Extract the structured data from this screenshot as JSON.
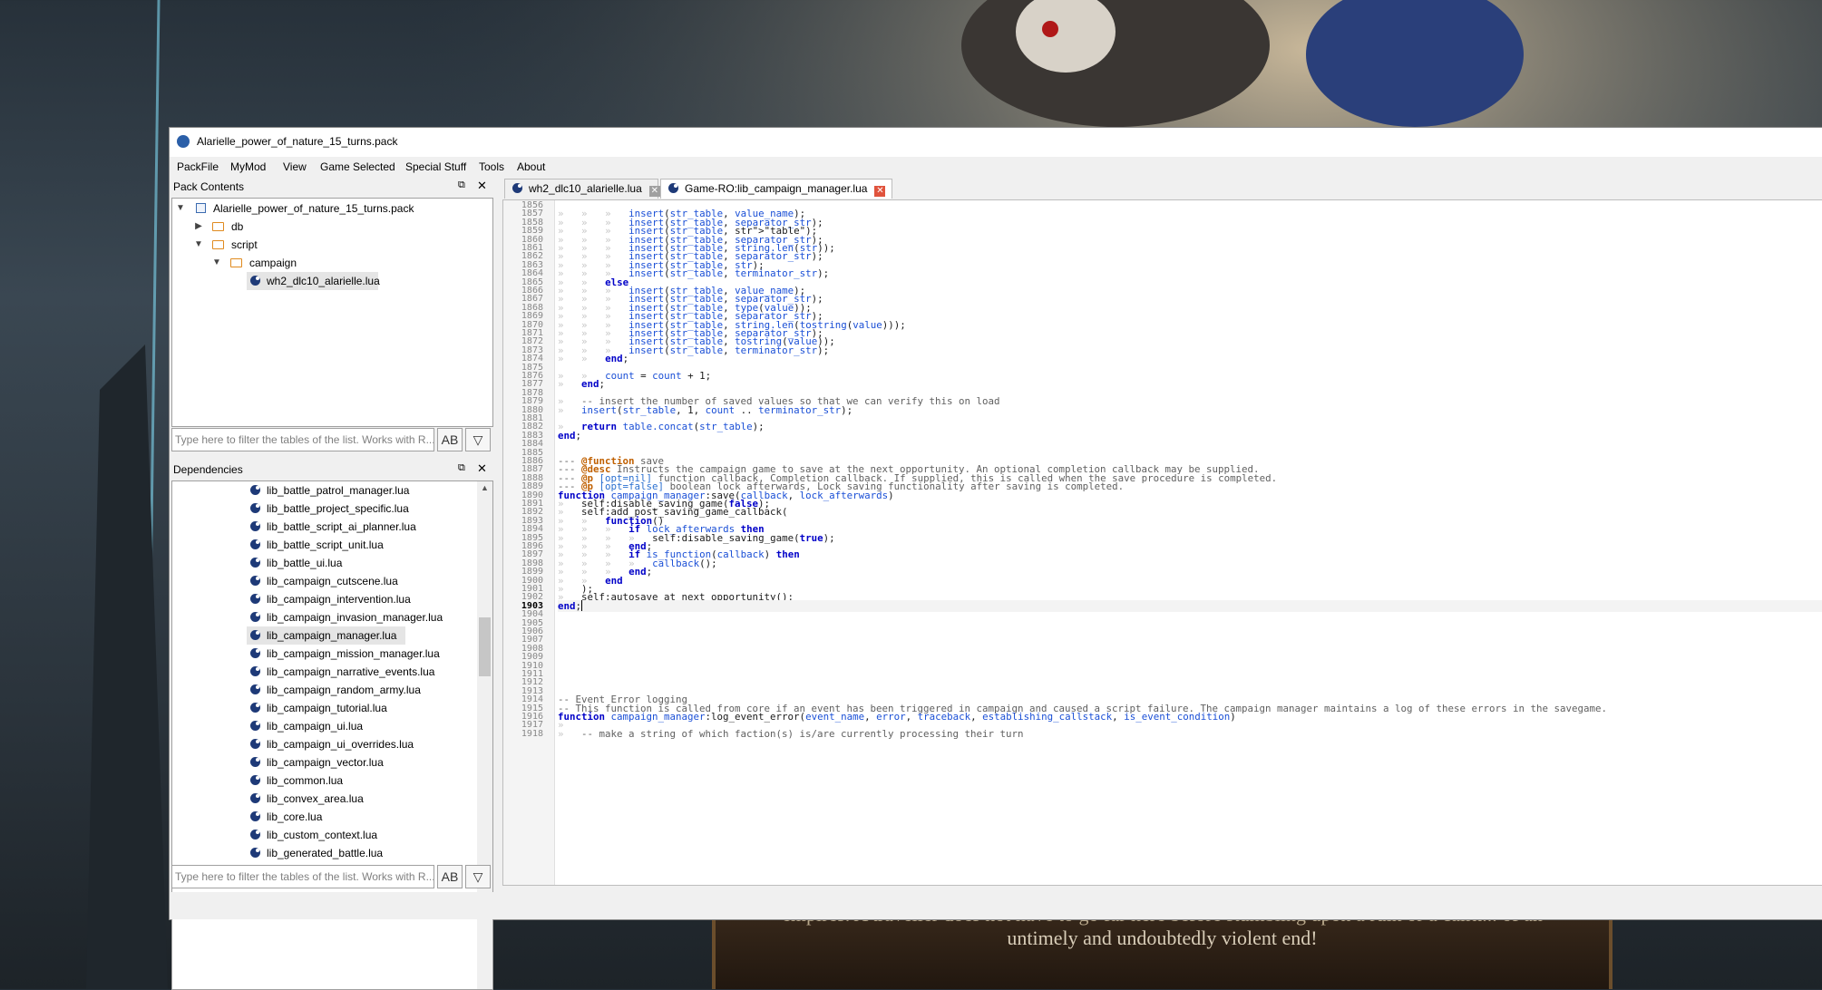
{
  "window": {
    "title": "Alarielle_power_of_nature_15_turns.pack"
  },
  "menu": [
    "PackFile",
    "MyMod",
    "View",
    "Game Selected",
    "Special Stuff",
    "Tools",
    "About"
  ],
  "pack_contents": {
    "title": "Pack Contents",
    "items": [
      {
        "label": "Alarielle_power_of_nature_15_turns.pack",
        "kind": "pack",
        "level": 0,
        "expanded": true
      },
      {
        "label": "db",
        "kind": "folder",
        "level": 1,
        "expanded": false
      },
      {
        "label": "script",
        "kind": "folder",
        "level": 1,
        "expanded": true
      },
      {
        "label": "campaign",
        "kind": "folder",
        "level": 2,
        "expanded": true
      },
      {
        "label": "wh2_dlc10_alarielle.lua",
        "kind": "lua",
        "level": 3,
        "selected": true
      }
    ],
    "filter_placeholder": "Type here to filter the tables of the list. Works with R...",
    "case_button": "AB"
  },
  "dependencies": {
    "title": "Dependencies",
    "items": [
      "lib_battle_patrol_manager.lua",
      "lib_battle_project_specific.lua",
      "lib_battle_script_ai_planner.lua",
      "lib_battle_script_unit.lua",
      "lib_battle_ui.lua",
      "lib_campaign_cutscene.lua",
      "lib_campaign_intervention.lua",
      "lib_campaign_invasion_manager.lua",
      "lib_campaign_manager.lua",
      "lib_campaign_mission_manager.lua",
      "lib_campaign_narrative_events.lua",
      "lib_campaign_random_army.lua",
      "lib_campaign_tutorial.lua",
      "lib_campaign_ui.lua",
      "lib_campaign_ui_overrides.lua",
      "lib_campaign_vector.lua",
      "lib_common.lua",
      "lib_convex_area.lua",
      "lib_core.lua",
      "lib_custom_context.lua",
      "lib_generated_battle.lua"
    ],
    "selected_index": 8,
    "filter_placeholder": "Type here to filter the tables of the list. Works with R...",
    "case_button": "AB"
  },
  "tabs": [
    {
      "label": "wh2_dlc10_alarielle.lua",
      "active": false
    },
    {
      "label": "Game-RO:lib_campaign_manager.lua",
      "active": true
    }
  ],
  "editor": {
    "current_line": 1903,
    "lines": [
      {
        "n": 1856,
        "t": ""
      },
      {
        "n": 1857,
        "t": "»   »   »   insert(str_table, value_name);"
      },
      {
        "n": 1858,
        "t": "»   »   »   insert(str_table, separator_str);"
      },
      {
        "n": 1859,
        "t": "»   »   »   insert(str_table, \"table\");"
      },
      {
        "n": 1860,
        "t": "»   »   »   insert(str_table, separator_str);"
      },
      {
        "n": 1861,
        "t": "»   »   »   insert(str_table, string.len(str));"
      },
      {
        "n": 1862,
        "t": "»   »   »   insert(str_table, separator_str);"
      },
      {
        "n": 1863,
        "t": "»   »   »   insert(str_table, str);"
      },
      {
        "n": 1864,
        "t": "»   »   »   insert(str_table, terminator_str);"
      },
      {
        "n": 1865,
        "t": "»   »   else"
      },
      {
        "n": 1866,
        "t": "»   »   »   insert(str_table, value_name);"
      },
      {
        "n": 1867,
        "t": "»   »   »   insert(str_table, separator_str);"
      },
      {
        "n": 1868,
        "t": "»   »   »   insert(str_table, type(value));"
      },
      {
        "n": 1869,
        "t": "»   »   »   insert(str_table, separator_str);"
      },
      {
        "n": 1870,
        "t": "»   »   »   insert(str_table, string.len(tostring(value)));"
      },
      {
        "n": 1871,
        "t": "»   »   »   insert(str_table, separator_str);"
      },
      {
        "n": 1872,
        "t": "»   »   »   insert(str_table, tostring(value));"
      },
      {
        "n": 1873,
        "t": "»   »   »   insert(str_table, terminator_str);"
      },
      {
        "n": 1874,
        "t": "»   »   end;"
      },
      {
        "n": 1875,
        "t": ""
      },
      {
        "n": 1876,
        "t": "»   »   count = count + 1;"
      },
      {
        "n": 1877,
        "t": "»   end;"
      },
      {
        "n": 1878,
        "t": ""
      },
      {
        "n": 1879,
        "t": "»   -- insert the number of saved values so that we can verify this on load"
      },
      {
        "n": 1880,
        "t": "»   insert(str_table, 1, count .. terminator_str);"
      },
      {
        "n": 1881,
        "t": ""
      },
      {
        "n": 1882,
        "t": "»   return table.concat(str_table);"
      },
      {
        "n": 1883,
        "t": "end;"
      },
      {
        "n": 1884,
        "t": ""
      },
      {
        "n": 1885,
        "t": ""
      },
      {
        "n": 1886,
        "t": "--- @function save"
      },
      {
        "n": 1887,
        "t": "--- @desc Instructs the campaign game to save at the next opportunity. An optional completion callback may be supplied."
      },
      {
        "n": 1888,
        "t": "--- @p [opt=nil] function callback, Completion callback. If supplied, this is called when the save procedure is completed."
      },
      {
        "n": 1889,
        "t": "--- @p [opt=false] boolean lock afterwards, Lock saving functionality after saving is completed."
      },
      {
        "n": 1890,
        "t": "function campaign_manager:save(callback, lock_afterwards)"
      },
      {
        "n": 1891,
        "t": "»   self:disable_saving_game(false);"
      },
      {
        "n": 1892,
        "t": "»   self:add_post_saving_game_callback("
      },
      {
        "n": 1893,
        "t": "»   »   function()"
      },
      {
        "n": 1894,
        "t": "»   »   »   if lock_afterwards then"
      },
      {
        "n": 1895,
        "t": "»   »   »   »   self:disable_saving_game(true);"
      },
      {
        "n": 1896,
        "t": "»   »   »   end;"
      },
      {
        "n": 1897,
        "t": "»   »   »   if is_function(callback) then"
      },
      {
        "n": 1898,
        "t": "»   »   »   »   callback();"
      },
      {
        "n": 1899,
        "t": "»   »   »   end;"
      },
      {
        "n": 1900,
        "t": "»   »   end"
      },
      {
        "n": 1901,
        "t": "»   );"
      },
      {
        "n": 1902,
        "t": "»   self:autosave_at_next_opportunity();"
      },
      {
        "n": 1903,
        "t": "end;"
      },
      {
        "n": 1904,
        "t": ""
      },
      {
        "n": 1905,
        "t": ""
      },
      {
        "n": 1906,
        "t": ""
      },
      {
        "n": 1907,
        "t": ""
      },
      {
        "n": 1908,
        "t": ""
      },
      {
        "n": 1909,
        "t": ""
      },
      {
        "n": 1910,
        "t": ""
      },
      {
        "n": 1911,
        "t": ""
      },
      {
        "n": 1912,
        "t": ""
      },
      {
        "n": 1913,
        "t": ""
      },
      {
        "n": 1914,
        "t": "-- Event Error logging"
      },
      {
        "n": 1915,
        "t": "-- This function is called from core if an event has been triggered in campaign and caused a script failure. The campaign manager maintains a log of these errors in the savegame."
      },
      {
        "n": 1916,
        "t": "function campaign_manager:log_event_error(event_name, error, traceback, establishing_callstack, is_event_condition)"
      },
      {
        "n": 1917,
        "t": "»"
      },
      {
        "n": 1918,
        "t": "»   -- make a string of which faction(s) is/are currently processing their turn"
      }
    ]
  },
  "background_caption": {
    "line1": "empires. A traveller does not have to go far here before stumbling upon a ruin or a cairn... of an",
    "line2": "untimely and undoubtedly violent end!"
  }
}
